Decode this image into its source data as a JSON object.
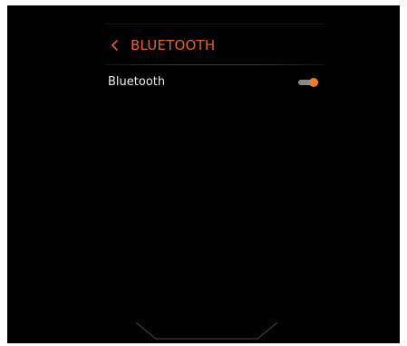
{
  "header": {
    "back_icon": "chevron-left-icon",
    "title": "BLUETOOTH"
  },
  "settings": {
    "bluetooth": {
      "label": "Bluetooth",
      "enabled": true
    }
  },
  "colors": {
    "background": "#000000",
    "accent": "#e4632a",
    "toggle_on": "#ef7d2a",
    "toggle_track": "#8a8a8a",
    "text": "#ececec"
  }
}
